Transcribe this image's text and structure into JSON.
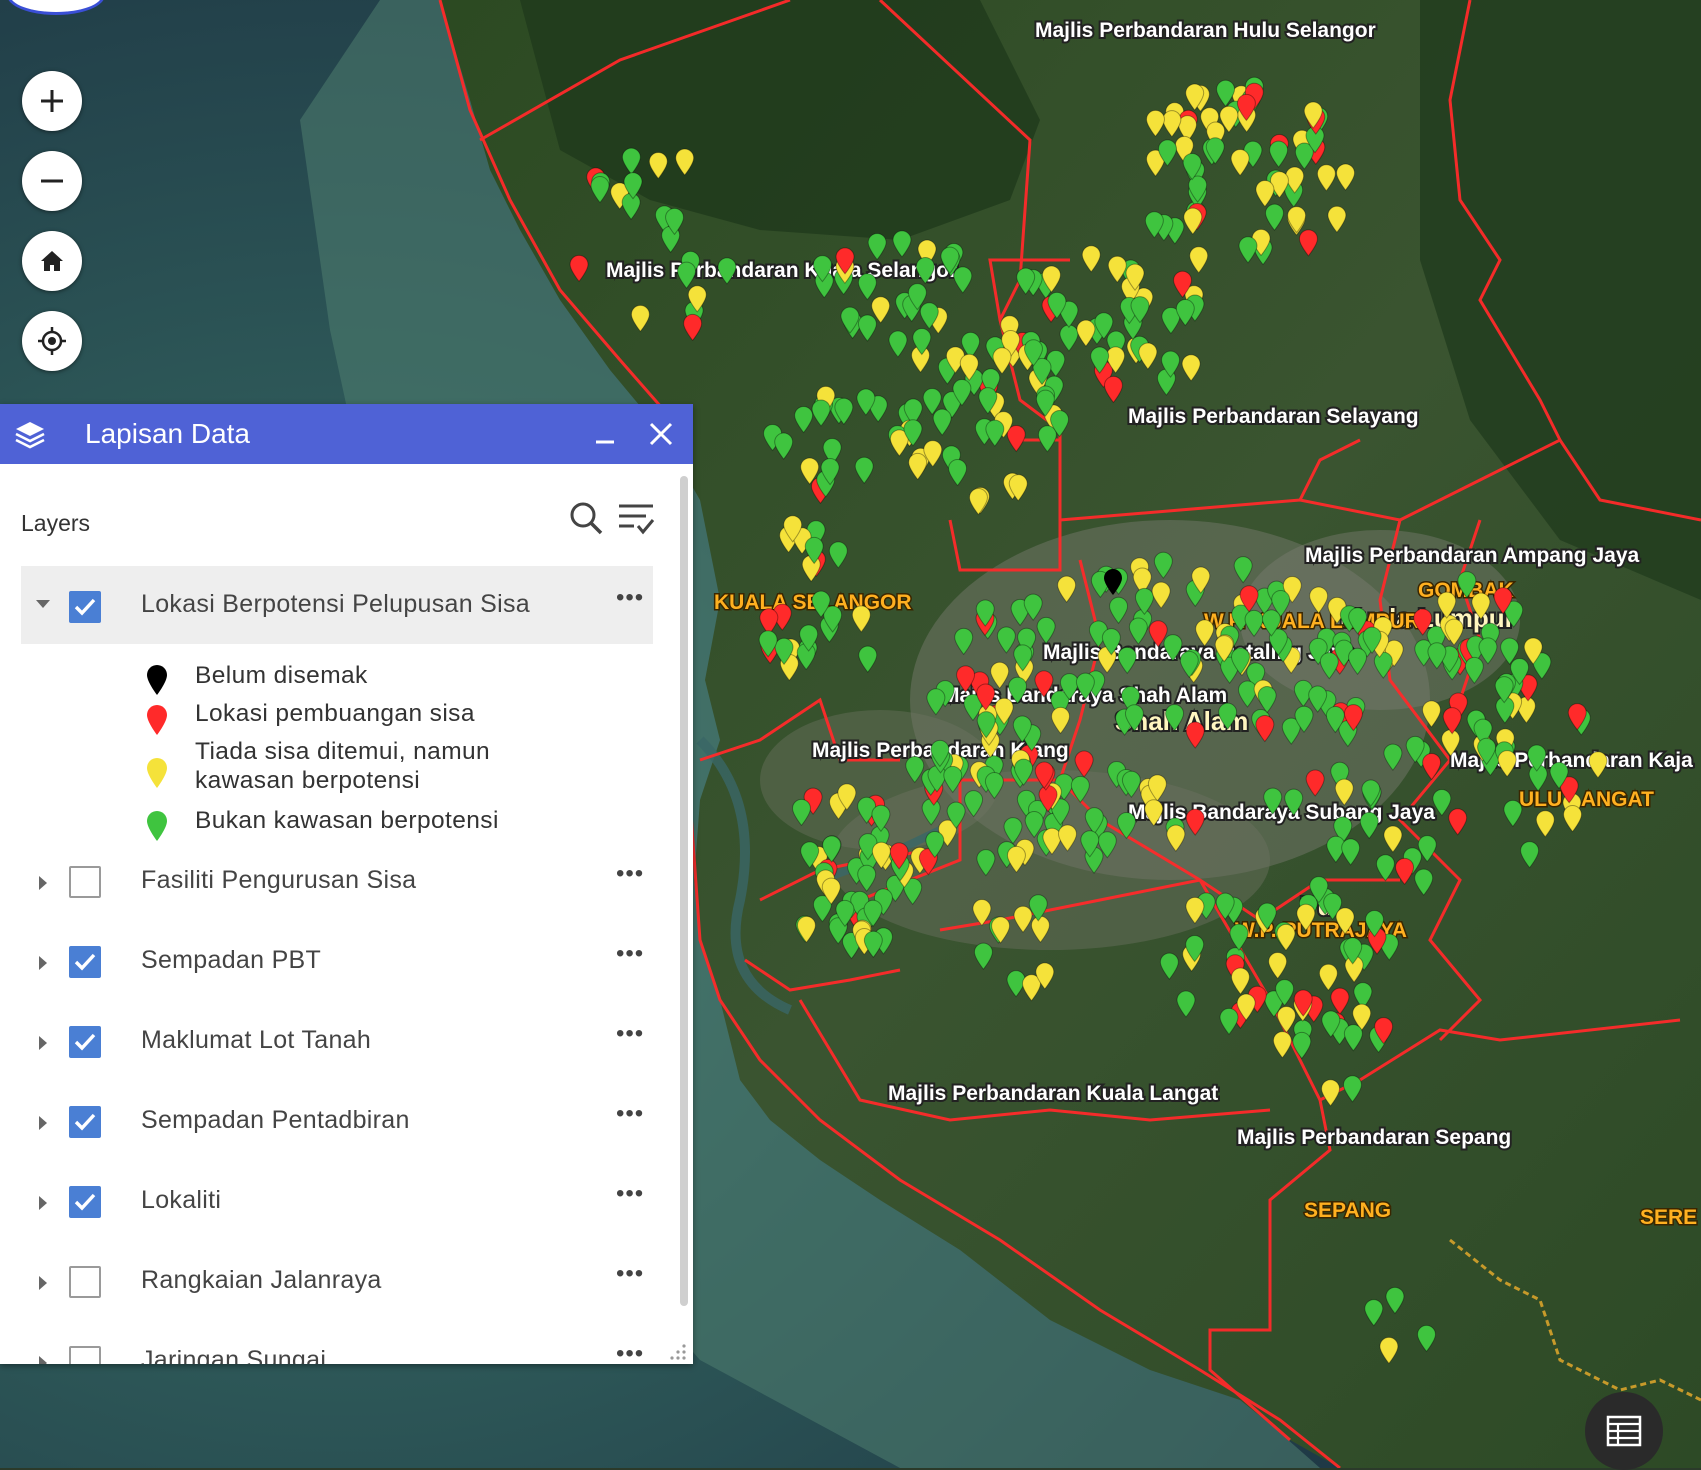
{
  "panel": {
    "title": "Lapisan Data",
    "layers_heading": "Layers",
    "layers": [
      {
        "name": "Lokasi Berpotensi Pelupusan Sisa",
        "checked": true,
        "expanded": true
      },
      {
        "name": "Fasiliti Pengurusan Sisa",
        "checked": false,
        "expanded": false
      },
      {
        "name": "Sempadan PBT",
        "checked": true,
        "expanded": false
      },
      {
        "name": "Maklumat Lot Tanah",
        "checked": true,
        "expanded": false
      },
      {
        "name": "Sempadan Pentadbiran",
        "checked": true,
        "expanded": false
      },
      {
        "name": "Lokaliti",
        "checked": true,
        "expanded": false
      },
      {
        "name": "Rangkaian Jalanraya",
        "checked": false,
        "expanded": false
      },
      {
        "name": "Jaringan Sungai",
        "checked": false,
        "expanded": false
      }
    ],
    "legend": [
      {
        "label": "Belum disemak",
        "color": "#000000"
      },
      {
        "label": "Lokasi pembuangan sisa",
        "color": "#ff2a2a"
      },
      {
        "label_line1": "Tiada sisa ditemui, namun",
        "label_line2": "kawasan berpotensi",
        "color": "#f5e23a"
      },
      {
        "label": "Bukan kawasan berpotensi",
        "color": "#3fc43f"
      }
    ]
  },
  "map_labels": {
    "pbt": [
      "Majlis Perbandaran Hulu Selangor",
      "Majlis Perbandaran Kuala Selangor",
      "Majlis Perbandaran Selayang",
      "Majlis Perbandaran Ampang Jaya",
      "Majlis Bandaraya Petaling Jaya",
      "Majlis Bandaraya Shah Alam",
      "Majlis Perbandaran Klang",
      "Majlis Perbandaran Kaja",
      "Majlis Bandaraya Subang Jaya",
      "Majlis Perbandaran Kuala Langat",
      "Majlis Perbandaran Sepang"
    ],
    "districts": [
      "KUALA SELANGOR",
      "GOMBAK",
      "W.P. KUALA LUMPUR",
      "ULU LANGAT",
      "W.P. PUTRAJAYA",
      "SEPANG",
      "SERE"
    ],
    "cities": [
      "Kuala Lumpur",
      "Shah Alam",
      "Pu"
    ]
  },
  "icons": {
    "zoom_in": "plus-icon",
    "zoom_out": "minus-icon",
    "home": "home-icon",
    "locate": "locate-icon",
    "layers": "layers-icon",
    "table": "table-icon"
  },
  "colors": {
    "header": "#4f62d6",
    "checkbox": "#4a7fd4",
    "boundary": "#ff2a2a"
  }
}
